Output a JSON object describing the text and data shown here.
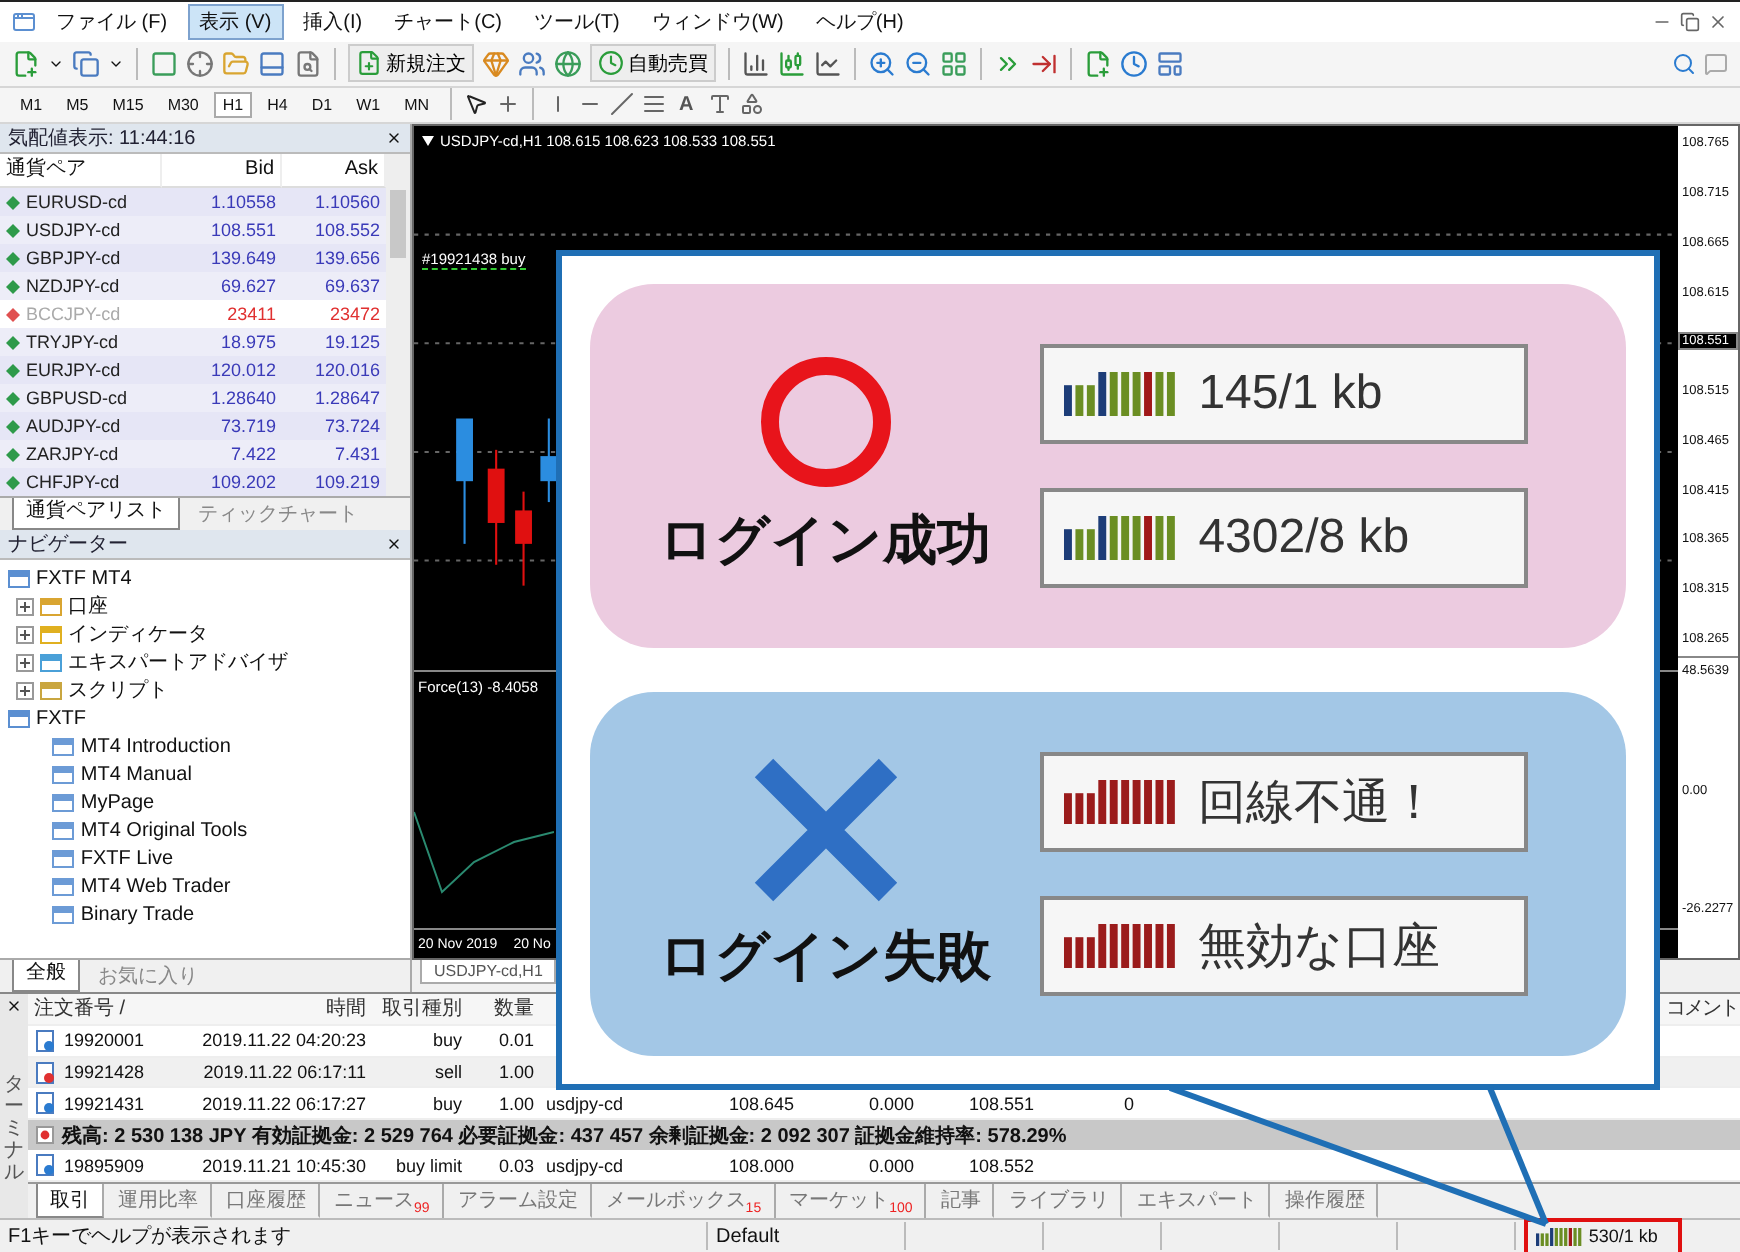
{
  "menu": [
    {
      "label": "ファイル (F)",
      "selected": false
    },
    {
      "label": "表示 (V)",
      "selected": true
    },
    {
      "label": "挿入(I)",
      "selected": false
    },
    {
      "label": "チャート(C)",
      "selected": false
    },
    {
      "label": "ツール(T)",
      "selected": false
    },
    {
      "label": "ウィンドウ(W)",
      "selected": false
    },
    {
      "label": "ヘルプ(H)",
      "selected": false
    }
  ],
  "toolbar": {
    "new_order": "新規注文",
    "auto_trading": "自動売買"
  },
  "timeframes": [
    {
      "label": "M1",
      "selected": false
    },
    {
      "label": "M5",
      "selected": false
    },
    {
      "label": "M15",
      "selected": false
    },
    {
      "label": "M30",
      "selected": false
    },
    {
      "label": "H1",
      "selected": true
    },
    {
      "label": "H4",
      "selected": false
    },
    {
      "label": "D1",
      "selected": false
    },
    {
      "label": "W1",
      "selected": false
    },
    {
      "label": "MN",
      "selected": false
    }
  ],
  "text_tool": "A",
  "market_watch": {
    "title": "気配値表示: 11:44:16",
    "columns": [
      "通貨ペア",
      "Bid",
      "Ask"
    ],
    "rows": [
      {
        "symbol": "EURUSD-cd",
        "bid": "1.10558",
        "ask": "1.10560",
        "disabled": false
      },
      {
        "symbol": "USDJPY-cd",
        "bid": "108.551",
        "ask": "108.552",
        "disabled": false
      },
      {
        "symbol": "GBPJPY-cd",
        "bid": "139.649",
        "ask": "139.656",
        "disabled": false
      },
      {
        "symbol": "NZDJPY-cd",
        "bid": "69.627",
        "ask": "69.637",
        "disabled": false
      },
      {
        "symbol": "BCCJPY-cd",
        "bid": "23411",
        "ask": "23472",
        "disabled": true
      },
      {
        "symbol": "TRYJPY-cd",
        "bid": "18.975",
        "ask": "19.125",
        "disabled": false
      },
      {
        "symbol": "EURJPY-cd",
        "bid": "120.012",
        "ask": "120.016",
        "disabled": false
      },
      {
        "symbol": "GBPUSD-cd",
        "bid": "1.28640",
        "ask": "1.28647",
        "disabled": false
      },
      {
        "symbol": "AUDJPY-cd",
        "bid": "73.719",
        "ask": "73.724",
        "disabled": false
      },
      {
        "symbol": "ZARJPY-cd",
        "bid": "7.422",
        "ask": "7.431",
        "disabled": false
      },
      {
        "symbol": "CHFJPY-cd",
        "bid": "109.202",
        "ask": "109.219",
        "disabled": false
      }
    ],
    "tabs": [
      {
        "label": "通貨ペアリスト",
        "selected": true
      },
      {
        "label": "ティックチャート",
        "selected": false
      }
    ]
  },
  "navigator": {
    "title": "ナビゲーター",
    "tree": [
      {
        "label": "FXTF MT4",
        "kind": "folder",
        "children": [
          {
            "label": "口座",
            "kind": "accounts",
            "expanded": false
          },
          {
            "label": "インディケータ",
            "kind": "indicators",
            "expanded": false
          },
          {
            "label": "エキスパートアドバイザ",
            "kind": "experts",
            "expanded": false
          },
          {
            "label": "スクリプト",
            "kind": "scripts",
            "expanded": false
          }
        ]
      },
      {
        "label": "FXTF",
        "kind": "folder",
        "children": [
          {
            "label": "MT4 Introduction",
            "kind": "link"
          },
          {
            "label": "MT4 Manual",
            "kind": "link"
          },
          {
            "label": "MyPage",
            "kind": "link"
          },
          {
            "label": "MT4 Original Tools",
            "kind": "link"
          },
          {
            "label": "FXTF Live",
            "kind": "link"
          },
          {
            "label": "MT4 Web Trader",
            "kind": "link"
          },
          {
            "label": "Binary Trade",
            "kind": "link"
          }
        ]
      }
    ],
    "tabs": [
      {
        "label": "全般",
        "selected": true
      },
      {
        "label": "お気に入り",
        "selected": false
      }
    ]
  },
  "chart": {
    "title": "USDJPY-cd,H1  108.615 108.623 108.533 108.551",
    "order_label": "#19921438 buy",
    "indicator_label": "Force(13) -8.4058",
    "dates": [
      "20 Nov 2019",
      "20 No"
    ],
    "price_labels": [
      {
        "label": "108.765",
        "highlighted": false
      },
      {
        "label": "108.715",
        "highlighted": false
      },
      {
        "label": "108.665",
        "highlighted": false
      },
      {
        "label": "108.615",
        "highlighted": false
      },
      {
        "label": "108.551",
        "highlighted": true
      },
      {
        "label": "108.515",
        "highlighted": false
      },
      {
        "label": "108.465",
        "highlighted": false
      },
      {
        "label": "108.415",
        "highlighted": false
      },
      {
        "label": "108.365",
        "highlighted": false
      },
      {
        "label": "108.315",
        "highlighted": false
      },
      {
        "label": "108.265",
        "highlighted": false
      }
    ],
    "indicator_labels": [
      "48.5639",
      "0.00",
      "-26.2277"
    ],
    "tabs": [
      {
        "label": "USDJPY-cd,H1",
        "selected": true
      }
    ]
  },
  "terminal": {
    "side_label": "ターミナル",
    "columns": [
      "注文番号 /",
      "時間",
      "取引種別",
      "数量",
      "コメント"
    ],
    "rows": [
      {
        "kind": "buy",
        "cells": [
          "19920001",
          "2019.11.22 04:20:23",
          "buy",
          "0.01"
        ]
      },
      {
        "kind": "sell",
        "cells": [
          "19921428",
          "2019.11.22 06:17:11",
          "sell",
          "1.00"
        ]
      },
      {
        "kind": "buy",
        "cells": [
          "19921431",
          "2019.11.22 06:17:27",
          "buy",
          "1.00",
          "usdjpy-cd",
          "108.645",
          "0.000",
          "108.551",
          "0"
        ]
      },
      {
        "kind": "summary",
        "text": "残高: 2 530 138 JPY  有効証拠金: 2 529 764  必要証拠金: 437 457  余剰証拠金: 2 092 307  証拠金維持率: 578.29%"
      },
      {
        "kind": "buy",
        "cells": [
          "19895909",
          "2019.11.21 10:45:30",
          "buy limit",
          "0.03",
          "usdjpy-cd",
          "108.000",
          "0.000",
          "108.552"
        ]
      }
    ],
    "tabs": [
      {
        "label": "取引",
        "selected": true
      },
      {
        "label": "運用比率",
        "selected": false
      },
      {
        "label": "口座履歴",
        "selected": false
      },
      {
        "label": "ニュース",
        "badge": "99",
        "selected": false
      },
      {
        "label": "アラーム設定",
        "selected": false
      },
      {
        "label": "メールボックス",
        "badge": "15",
        "selected": false
      },
      {
        "label": "マーケット",
        "badge": "100",
        "selected": false
      },
      {
        "label": "記事",
        "selected": false
      },
      {
        "label": "ライブラリ",
        "selected": false
      },
      {
        "label": "エキスパート",
        "selected": false
      },
      {
        "label": "操作履歴",
        "selected": false
      }
    ]
  },
  "status_bar": {
    "help": "F1キーでヘルプが表示されます",
    "profile": "Default",
    "traffic": "530/1 kb",
    "highlighted": true
  },
  "callout": {
    "panels": [
      {
        "kind": "success",
        "title": "ログイン成功",
        "readings": [
          "145/1 kb",
          "4302/8 kb"
        ]
      },
      {
        "kind": "failure",
        "title": "ログイン失敗",
        "readings": [
          "回線不通！",
          "無効な口座"
        ]
      }
    ]
  }
}
